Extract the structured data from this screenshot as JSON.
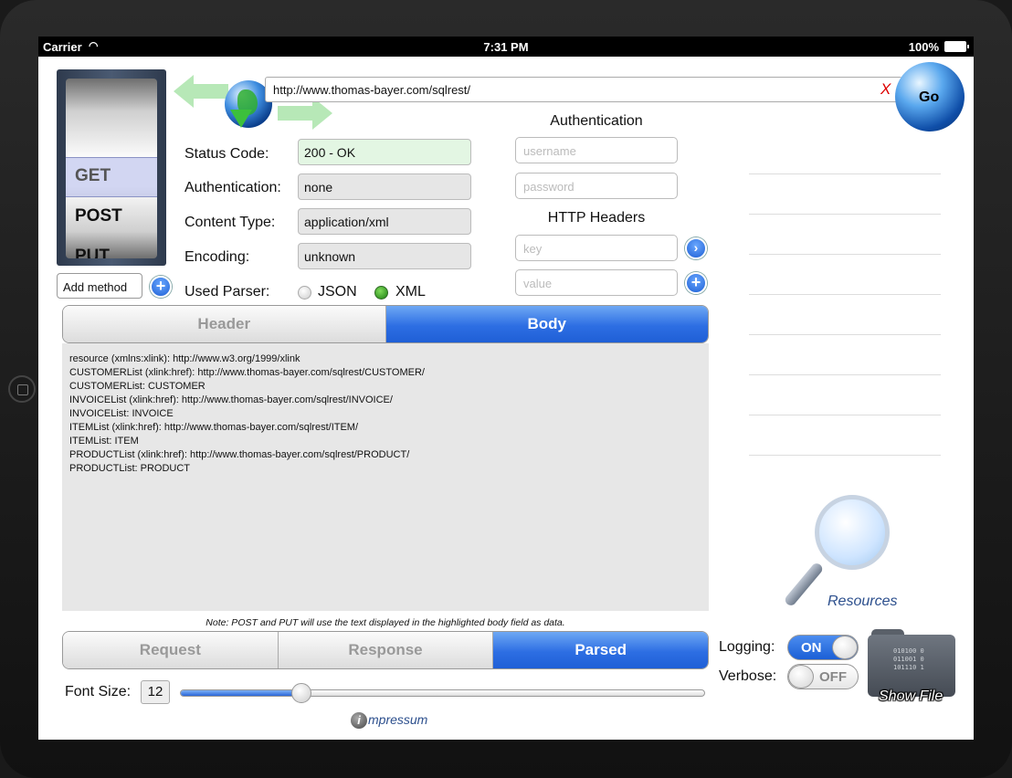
{
  "statusbar": {
    "carrier": "Carrier",
    "time": "7:31 PM",
    "battery": "100%"
  },
  "method_picker": {
    "items": [
      "GET",
      "POST",
      "PUT"
    ],
    "selected": "GET",
    "add_placeholder": "Add method"
  },
  "url": {
    "value": "http://www.thomas-bayer.com/sqlrest/",
    "clear_label": "X",
    "go_label": "Go"
  },
  "status": {
    "status_code_label": "Status Code:",
    "status_code_value": "200 - OK",
    "authentication_label": "Authentication:",
    "authentication_value": "none",
    "content_type_label": "Content Type:",
    "content_type_value": "application/xml",
    "encoding_label": "Encoding:",
    "encoding_value": "unknown",
    "parser_label": "Used Parser:",
    "parser_json": "JSON",
    "parser_xml": "XML",
    "parser_selected": "XML"
  },
  "auth": {
    "title": "Authentication",
    "username_placeholder": "username",
    "password_placeholder": "password"
  },
  "headers": {
    "title": "HTTP Headers",
    "key_placeholder": "key",
    "value_placeholder": "value"
  },
  "tabs": {
    "header": "Header",
    "body": "Body",
    "active": "Body"
  },
  "body_lines": [
    "resource (xmlns:xlink): http://www.w3.org/1999/xlink",
    "CUSTOMERList (xlink:href): http://www.thomas-bayer.com/sqlrest/CUSTOMER/",
    "CUSTOMERList: CUSTOMER",
    "INVOICEList (xlink:href): http://www.thomas-bayer.com/sqlrest/INVOICE/",
    "INVOICEList: INVOICE",
    "ITEMList (xlink:href): http://www.thomas-bayer.com/sqlrest/ITEM/",
    "ITEMList: ITEM",
    "PRODUCTList (xlink:href): http://www.thomas-bayer.com/sqlrest/PRODUCT/",
    "PRODUCTList: PRODUCT"
  ],
  "note": "Note: POST and PUT will use the text displayed in the highlighted body field as data.",
  "view_mode": {
    "request": "Request",
    "response": "Response",
    "parsed": "Parsed",
    "active": "Parsed"
  },
  "font_size": {
    "label": "Font Size:",
    "value": "12",
    "slider_fraction": 0.23
  },
  "impressum": {
    "icon_letter": "i",
    "label": "mpressum"
  },
  "resources": {
    "label": "Resources",
    "icon": "magnifier-icon"
  },
  "logging": {
    "label": "Logging:",
    "state": "ON"
  },
  "verbose": {
    "label": "Verbose:",
    "state": "OFF"
  },
  "show_file": {
    "label": "Show File",
    "code": [
      "010100 0",
      "011001 0",
      "101110 1"
    ]
  },
  "colors": {
    "accent_blue": "#2d6ee3",
    "status_ok_bg": "#e3f6e3",
    "link_blue": "#2c4f8d"
  }
}
